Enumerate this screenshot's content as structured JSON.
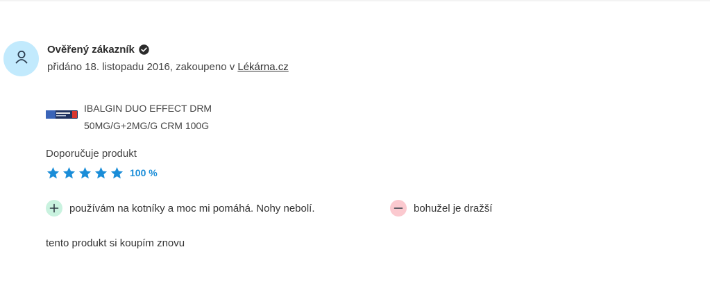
{
  "reviewer": {
    "name": "Ověřený zákazník",
    "added_prefix": "přidáno 18. listopadu 2016, zakoupeno v ",
    "store_link": "Lékárna.cz"
  },
  "product": {
    "line1": "IBALGIN DUO EFFECT DRM",
    "line2": "50MG/G+2MG/G CRM 100G"
  },
  "rating": {
    "label": "Doporučuje produkt",
    "stars_filled": 5,
    "stars_total": 5,
    "percent_text": "100 %",
    "star_color": "#1a8dd8"
  },
  "pros": {
    "text": "používám na kotníky a moc mi pomáhá. Nohy nebolí."
  },
  "cons": {
    "text": "bohužel je dražší"
  },
  "review": {
    "text": "tento produkt si koupím znovu"
  },
  "icons": {
    "avatar": "user-icon",
    "verified": "check-circle-icon",
    "pro": "plus-icon",
    "con": "minus-icon",
    "star": "star-icon"
  },
  "colors": {
    "avatar_bg": "#c2eafd",
    "plus_bg": "#c9f2df",
    "minus_bg": "#fbc9cf",
    "accent": "#1a8dd8"
  }
}
